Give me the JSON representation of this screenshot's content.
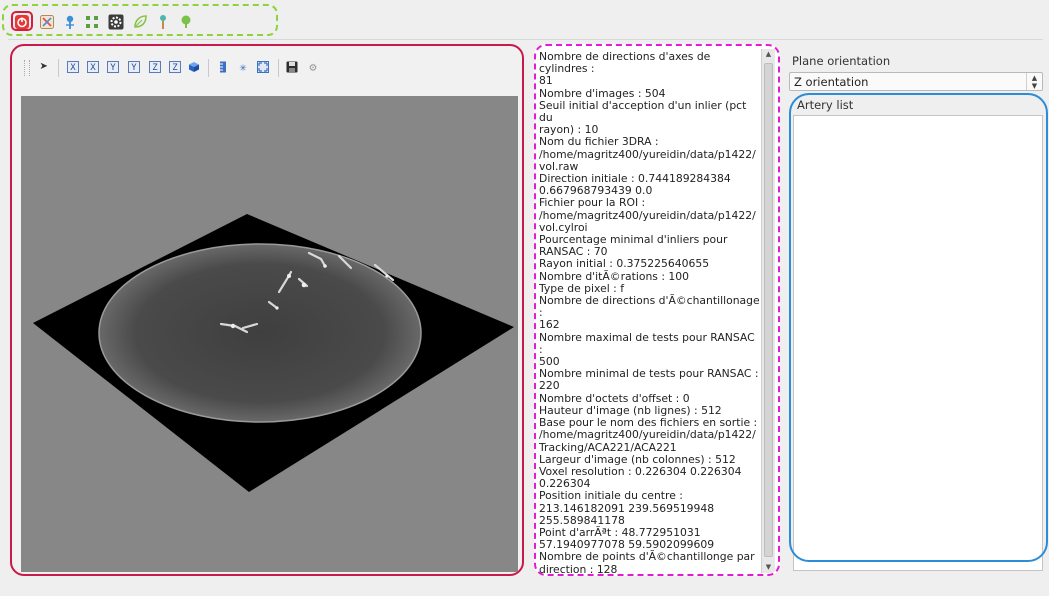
{
  "toolbar_icons": [
    "power-icon",
    "tools-icon",
    "pin-icon",
    "move-icon",
    "gear-dark-icon",
    "leaf-icon",
    "marker-icon",
    "tree-icon"
  ],
  "viewer_toolbar": {
    "view_buttons": [
      "X",
      "X",
      "Y",
      "Y",
      "Z",
      "Z"
    ]
  },
  "info": {
    "lines": [
      "Nombre de directions d'axes de cylindres :",
      "81",
      "Nombre d'images : 504",
      "Seuil initial d'acception d'un inlier (pct du",
      "rayon) : 10",
      "Nom du fichier 3DRA :",
      "/home/magritz400/yureidin/data/p1422/",
      "vol.raw",
      "Direction initiale : 0.744189284384",
      "0.667968793439 0.0",
      "Fichier pour la ROI :",
      "/home/magritz400/yureidin/data/p1422/",
      "vol.cylroi",
      "Pourcentage minimal d'inliers pour",
      "RANSAC : 70",
      "Rayon initial : 0.375225640655",
      "Nombre d'itÃ©rations : 100",
      "Type de pixel : f",
      "Nombre de directions d'Ã©chantillonage :",
      "162",
      "Nombre maximal de tests pour RANSAC :",
      "500",
      "Nombre minimal de tests pour RANSAC :",
      "220",
      "Nombre d'octets d'offset : 0",
      "Hauteur d'image (nb lignes) : 512",
      "Base pour le nom des fichiers en sortie :",
      "/home/magritz400/yureidin/data/p1422/",
      "Tracking/ACA221/ACA221",
      "Largeur d'image (nb colonnes) : 512",
      "Voxel resolution : 0.226304 0.226304",
      "0.226304",
      "Position initiale du centre :",
      "213.146182091 239.569519948",
      "255.589841178",
      "Point d'arrÃªt : 48.772951031",
      "57.1940977078 59.5902099609",
      "Nombre de points d'Ã©chantillonge par",
      "direction : 128"
    ]
  },
  "right": {
    "plane_label": "Plane orientation",
    "plane_value": "Z orientation",
    "artery_label": "Artery list"
  },
  "colors": {
    "toolbar_ring": "#8fd33a",
    "viewer_ring": "#c8184c",
    "info_ring": "#e21cd4",
    "artery_ring": "#2b8cd8",
    "viewport_bg": "#878787"
  }
}
